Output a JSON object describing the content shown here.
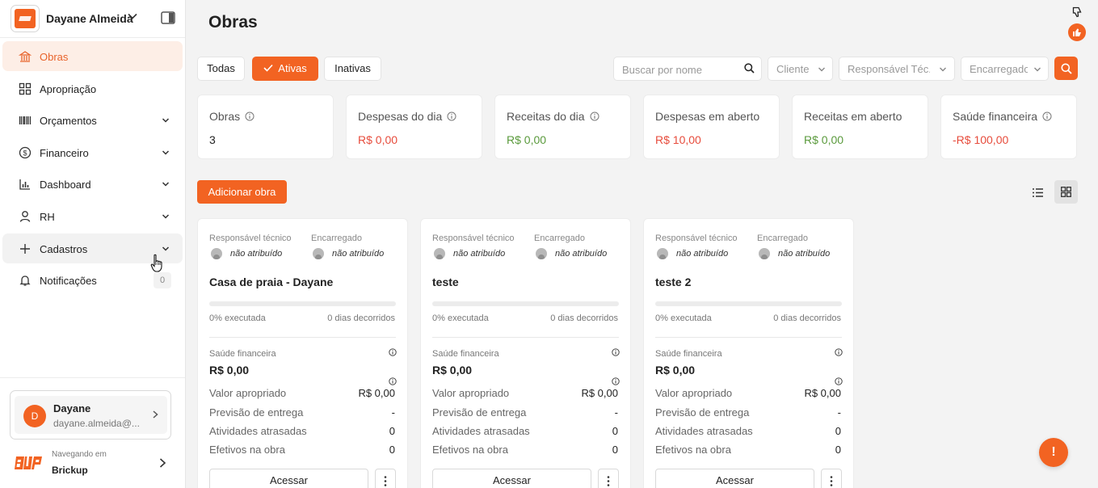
{
  "sidebar": {
    "workspace_name": "Dayane Almeida",
    "items": [
      {
        "label": "Obras"
      },
      {
        "label": "Apropriação"
      },
      {
        "label": "Orçamentos"
      },
      {
        "label": "Financeiro"
      },
      {
        "label": "Dashboard"
      },
      {
        "label": "RH"
      },
      {
        "label": "Cadastros"
      },
      {
        "label": "Notificações",
        "badge": "0"
      }
    ],
    "user": {
      "initial": "D",
      "name": "Dayane",
      "email": "dayane.almeida@..."
    },
    "navigating_label": "Navegando em",
    "navigating_name": "Brickup"
  },
  "main": {
    "title": "Obras",
    "filters": {
      "all": "Todas",
      "active": "Ativas",
      "inactive": "Inativas"
    },
    "search_placeholder": "Buscar por nome",
    "selects": {
      "client": "Cliente",
      "responsible": "Responsável Téc.",
      "foreman": "Encarregado"
    },
    "stats": [
      {
        "label": "Obras",
        "value": "3"
      },
      {
        "label": "Despesas do dia",
        "value": "R$ 0,00"
      },
      {
        "label": "Receitas do dia",
        "value": "R$ 0,00"
      },
      {
        "label": "Despesas em aberto",
        "value": "R$ 10,00"
      },
      {
        "label": "Receitas em aberto",
        "value": "R$ 0,00"
      },
      {
        "label": "Saúde financeira",
        "value": "-R$ 100,00"
      }
    ],
    "add_button": "Adicionar obra",
    "card_labels": {
      "responsible": "Responsável técnico",
      "foreman": "Encarregado",
      "unassigned": "não atribuído",
      "health": "Saúde financeira",
      "appropriated": "Valor apropriado",
      "delivery": "Previsão de entrega",
      "late": "Atividades atrasadas",
      "workers": "Efetivos na obra",
      "access": "Acessar"
    },
    "cards": [
      {
        "title": "Casa de praia - Dayane",
        "progress": 0,
        "executed": "0% executada",
        "days": "0 dias decorridos",
        "health": "R$ 0,00",
        "appropriated": "R$ 0,00",
        "delivery": "-",
        "late": "0",
        "workers": "0"
      },
      {
        "title": "teste",
        "progress": 0,
        "executed": "0% executada",
        "days": "0 dias decorridos",
        "health": "R$ 0,00",
        "appropriated": "R$ 0,00",
        "delivery": "-",
        "late": "0",
        "workers": "0"
      },
      {
        "title": "teste 2",
        "progress": 0,
        "executed": "0% executada",
        "days": "0 dias decorridos",
        "health": "R$ 0,00",
        "appropriated": "R$ 0,00",
        "delivery": "-",
        "late": "0",
        "workers": "0"
      }
    ],
    "fab_label": "!"
  },
  "colors": {
    "accent": "#f26322",
    "negative": "#e74c3c",
    "positive": "#5a9a3c"
  },
  "icons": [
    "building-icon",
    "grid-icon",
    "barcode-icon",
    "dollar-icon",
    "chart-icon",
    "person-icon",
    "plus-icon",
    "bell-icon",
    "search-icon",
    "info-icon",
    "list-icon",
    "more-icon"
  ]
}
